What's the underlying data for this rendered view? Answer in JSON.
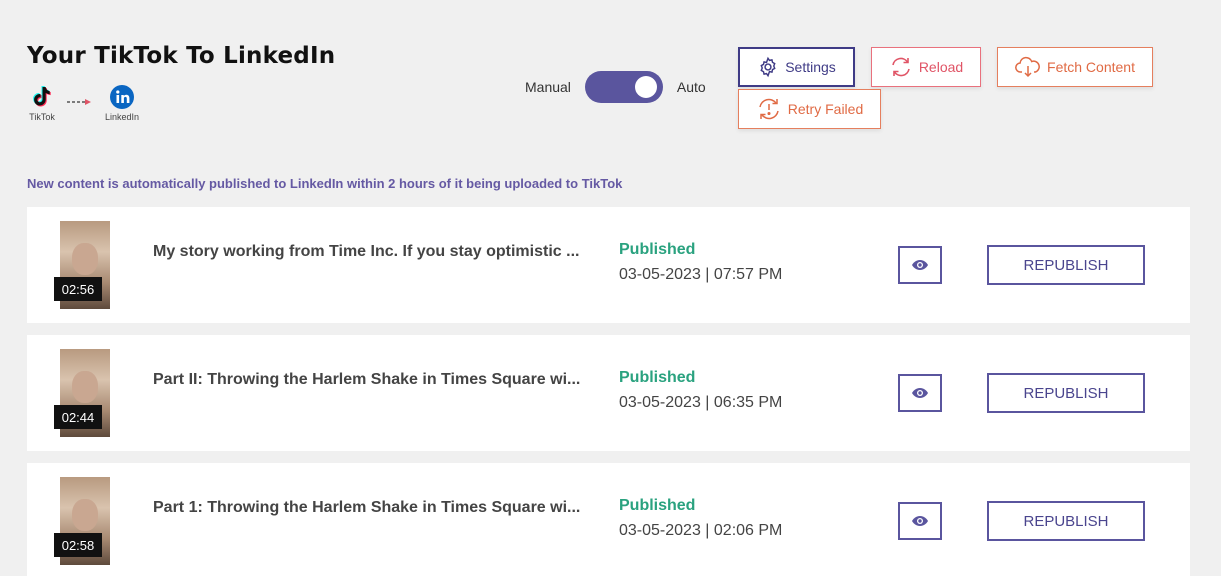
{
  "header": {
    "title": "Your TikTok To LinkedIn",
    "flow": {
      "source_label": "TikTok",
      "target_label": "LinkedIn",
      "source_icon": "tiktok-icon",
      "target_icon": "linkedin-icon"
    }
  },
  "mode_toggle": {
    "left_label": "Manual",
    "right_label": "Auto",
    "state": "Auto"
  },
  "toolbar": {
    "settings_label": "Settings",
    "reload_label": "Reload",
    "fetch_label": "Fetch Content",
    "retry_label": "Retry Failed"
  },
  "notice": "New content is automatically published to LinkedIn within 2 hours of it being uploaded to TikTok",
  "posts": [
    {
      "duration": "02:56",
      "title": "My story working from Time Inc. If you stay optimistic ...",
      "status": "Published",
      "date": "03-05-2023 | 07:57 PM",
      "action_label": "REPUBLISH"
    },
    {
      "duration": "02:44",
      "title": "Part II: Throwing the Harlem Shake in Times Square wi...",
      "status": "Published",
      "date": "03-05-2023 | 06:35 PM",
      "action_label": "REPUBLISH"
    },
    {
      "duration": "02:58",
      "title": "Part 1: Throwing the Harlem Shake in Times Square wi...",
      "status": "Published",
      "date": "03-05-2023 | 02:06 PM",
      "action_label": "REPUBLISH"
    }
  ],
  "colors": {
    "accent": "#5a559e",
    "published": "#2aa27f",
    "reload": "#e05466",
    "fetch": "#e06a44"
  }
}
